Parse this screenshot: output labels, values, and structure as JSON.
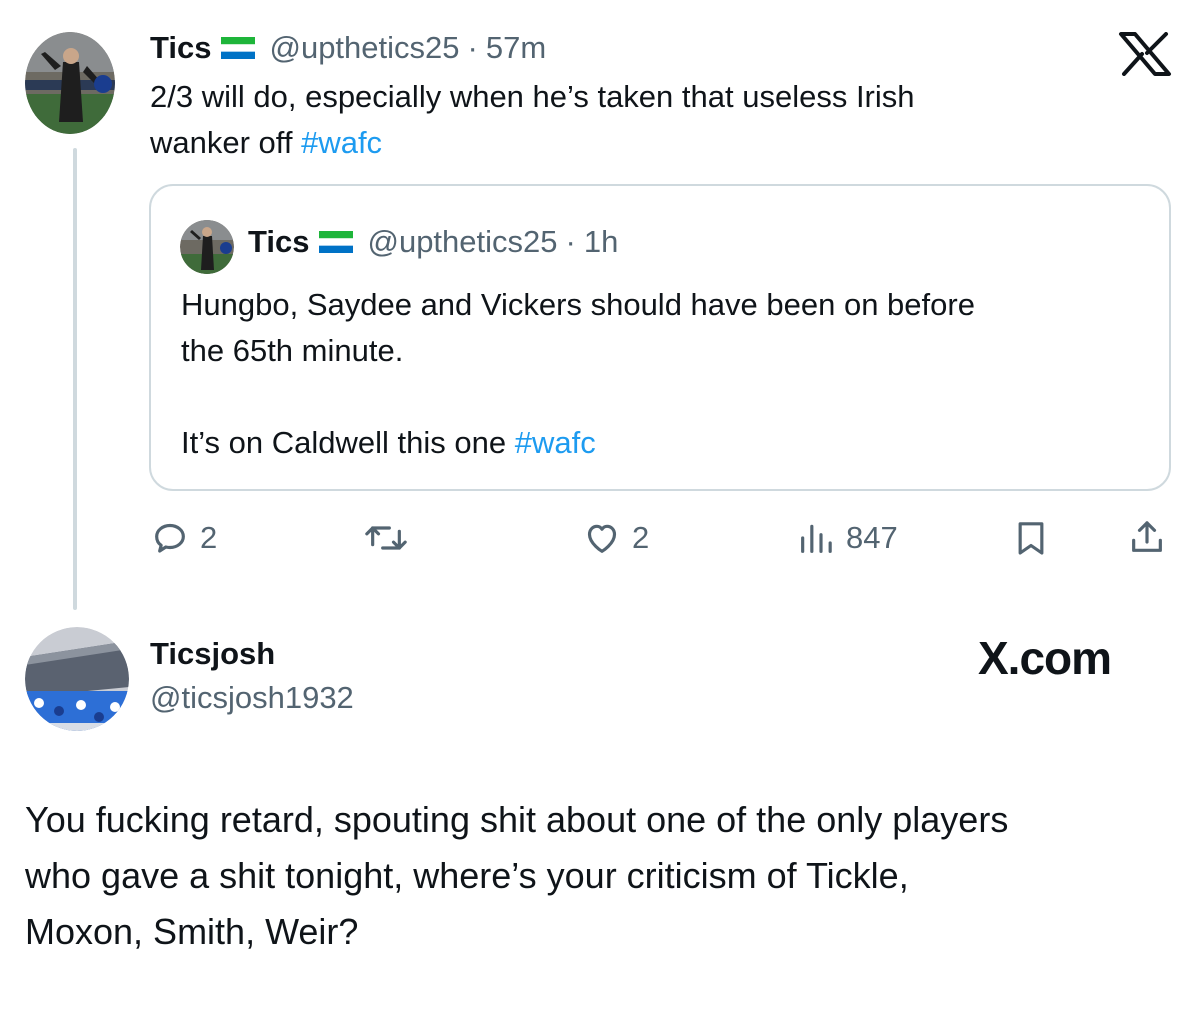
{
  "colors": {
    "text": "#0f1419",
    "secondary": "#536471",
    "link": "#1d9bf0",
    "border": "#cfd9de",
    "thread_line": "#cfd9de"
  },
  "tweet": {
    "author_name": "Tics",
    "author_flag": "sierra-leone-flag-icon",
    "handle": "@upthetics25",
    "separator": "·",
    "time": "57m",
    "text_line1": "2/3 will do, especially when he’s taken that useless Irish",
    "text_line2": "wanker off",
    "hashtag": "#wafc",
    "logo_icon": "x-logo-icon"
  },
  "quote": {
    "author_name": "Tics",
    "author_flag": "sierra-leone-flag-icon",
    "handle": "@upthetics25",
    "separator": "·",
    "time": "1h",
    "line1": "Hungbo, Saydee and Vickers should have been on before",
    "line2": "the 65th minute.",
    "line3": "It’s on Caldwell this one",
    "hashtag": "#wafc"
  },
  "actions": {
    "replies": "2",
    "likes": "2",
    "views": "847"
  },
  "reply": {
    "author_name": "Ticsjosh",
    "handle": "@ticsjosh1932",
    "brand": "X.com",
    "line1": "You fucking retard, spouting shit about one of the only players",
    "line2": "who gave a shit tonight, where’s your criticism of Tickle,",
    "line3": "Moxon, Smith, Weir?"
  }
}
